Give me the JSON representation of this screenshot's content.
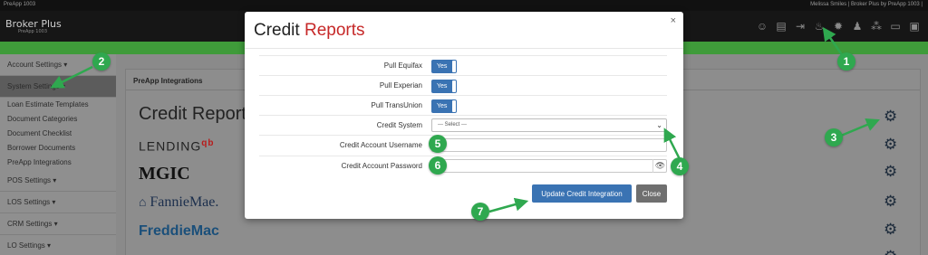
{
  "app": {
    "topbar_left": "PreApp 1003",
    "topbar_right": "Melissa Smiles | Broker Plus by PreApp 1003 |",
    "logo_text": "Broker Plus",
    "logo_sub": "PreApp 1003"
  },
  "header_icons": [
    "user-circle-icon",
    "document-icon",
    "export-icon",
    "flame-icon",
    "settings-icon",
    "user-settings-icon",
    "network-icon",
    "monitor-icon",
    "window-icon"
  ],
  "sidebar": {
    "items": [
      {
        "label": "Account Settings ▾"
      },
      {
        "label": "System Settings ▾"
      }
    ],
    "subitems": [
      {
        "label": "Loan Estimate Templates"
      },
      {
        "label": "Document Categories"
      },
      {
        "label": "Document Checklist"
      },
      {
        "label": "Borrower Documents"
      },
      {
        "label": "PreApp Integrations"
      }
    ],
    "lower_items": [
      {
        "label": "POS Settings ▾"
      },
      {
        "label": "LOS Settings ▾"
      },
      {
        "label": "CRM Settings ▾"
      },
      {
        "label": "LO Settings ▾"
      }
    ]
  },
  "panel": {
    "title": "PreApp Integrations",
    "providers": [
      {
        "name": "Credit Reports"
      },
      {
        "name": "LENDING",
        "sup": "qb"
      },
      {
        "name": "MGIC"
      },
      {
        "name": "FannieMae."
      },
      {
        "name": "FreddieMac"
      }
    ]
  },
  "modal": {
    "title_a": "Credit",
    "title_b": "Reports",
    "close_symbol": "×",
    "fields": {
      "pull_equifax": {
        "label": "Pull Equifax",
        "value": "Yes"
      },
      "pull_experian": {
        "label": "Pull Experian",
        "value": "Yes"
      },
      "pull_transunion": {
        "label": "Pull TransUnion",
        "value": "Yes"
      },
      "credit_system": {
        "label": "Credit System",
        "value": "--- Select ---"
      },
      "username": {
        "label": "Credit Account Username",
        "value": ""
      },
      "password": {
        "label": "Credit Account Password",
        "value": ""
      }
    },
    "update_button": "Update Credit Integration",
    "close_button": "Close"
  },
  "callouts": [
    "1",
    "2",
    "3",
    "4",
    "5",
    "6",
    "7"
  ],
  "colors": {
    "accent_green": "#3f9b3a",
    "callout_green": "#2fa84f",
    "primary_blue": "#3a73b3",
    "title_red": "#c62828"
  }
}
